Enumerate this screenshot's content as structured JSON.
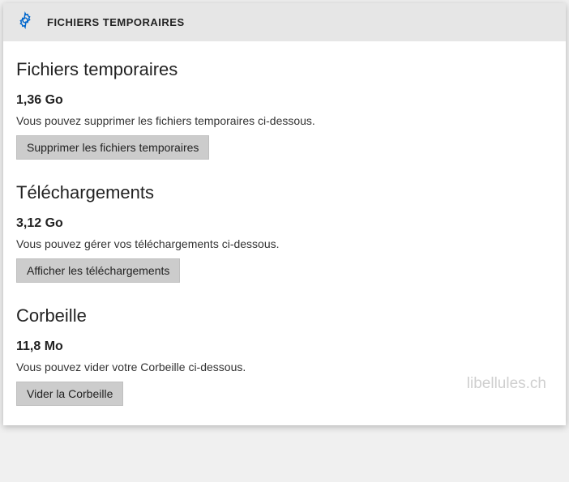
{
  "header": {
    "title": "FICHIERS TEMPORAIRES"
  },
  "sections": {
    "temp": {
      "title": "Fichiers temporaires",
      "size": "1,36 Go",
      "desc": "Vous pouvez supprimer les fichiers temporaires ci-dessous.",
      "button": "Supprimer les fichiers temporaires"
    },
    "downloads": {
      "title": "Téléchargements",
      "size": "3,12 Go",
      "desc": "Vous pouvez gérer vos téléchargements ci-dessous.",
      "button": "Afficher les téléchargements"
    },
    "trash": {
      "title": "Corbeille",
      "size": "11,8 Mo",
      "desc": "Vous pouvez vider votre Corbeille ci-dessous.",
      "button": "Vider la Corbeille"
    }
  },
  "watermark": "libellules.ch"
}
